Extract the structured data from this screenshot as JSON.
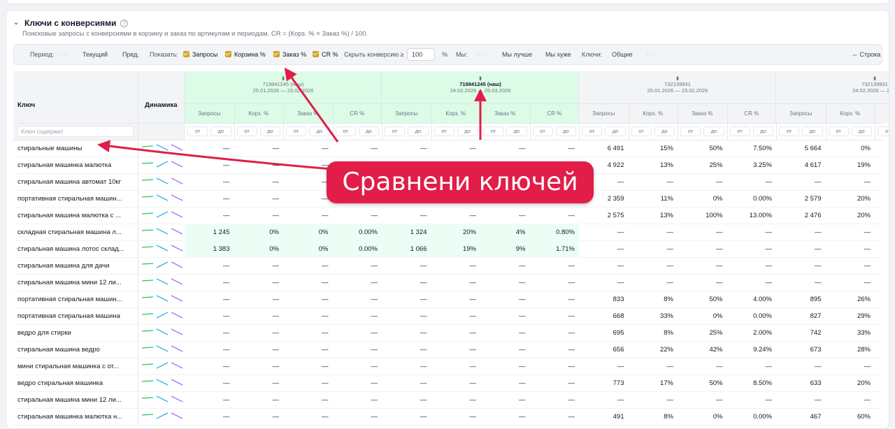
{
  "header": {
    "title": "Ключи с конверсиями",
    "subtitle": "Поисковые запросы с конверсиями в корзину и заказ по артикулам и периодам. CR = (Корз. % × Заказ %) / 100."
  },
  "toolbar": {
    "period_label": "Период:",
    "period_faded": "Оба",
    "period_current": "Текущий",
    "period_prev": "Пред.",
    "show_label": "Показать:",
    "chk_requests": "Запросы",
    "chk_cart": "Корзина %",
    "chk_order": "Заказ %",
    "chk_cr": "CR %",
    "hide_conv_label": "Скрыть конверсию ≥",
    "hide_conv_value": "100",
    "pct": "%",
    "we_label": "Мы:",
    "we_faded": "Все",
    "we_better": "Мы лучше",
    "we_worse": "Мы хуже",
    "keys_label": "Ключи:",
    "keys_common": "Общие",
    "keys_faded": "Все",
    "row_toggle": "⇔ Строка"
  },
  "colors": {
    "accent": "#d6a21e",
    "green_header": "#dcfce7",
    "green_row": "#ecfdf5",
    "banner": "#e11d48"
  },
  "table": {
    "key_header": "Ключ",
    "dyn_header": "Динамика",
    "filter_placeholder": "Ключ содержит",
    "groups": [
      {
        "id": "719841245 (наш)",
        "dates": "25.01.2026 — 23.02.2026",
        "green": true,
        "bold": false
      },
      {
        "id": "719841245 (наш)",
        "dates": "24.02.2026 — 25.03.2026",
        "green": true,
        "bold": true
      },
      {
        "id": "732139931",
        "dates": "25.01.2026 — 23.02.2026",
        "green": false,
        "bold": false
      },
      {
        "id": "732139931",
        "dates": "24.02.2026 — 25.0",
        "green": false,
        "bold": false
      }
    ],
    "subcols": [
      "Запросы",
      "Корз. %",
      "Заказ %",
      "CR %"
    ],
    "from": "от",
    "to": "до",
    "rows": [
      {
        "key": "стиральные машины",
        "hl": false,
        "v": [
          "—",
          "—",
          "—",
          "—",
          "—",
          "—",
          "—",
          "—",
          "6 491",
          "15%",
          "50%",
          "7.50%",
          "5 664",
          "0%"
        ]
      },
      {
        "key": "стиральная машинка малютка",
        "hl": false,
        "v": [
          "—",
          "—",
          "—",
          "—",
          "—",
          "—",
          "—",
          "—",
          "4 922",
          "13%",
          "25%",
          "3.25%",
          "4 617",
          "19%"
        ]
      },
      {
        "key": "стиральная машина автомат 10кг",
        "hl": false,
        "v": [
          "—",
          "—",
          "—",
          "—",
          "—",
          "—",
          "—",
          "—",
          "—",
          "—",
          "—",
          "—",
          "—",
          "—"
        ]
      },
      {
        "key": "портативная стиральная машин...",
        "hl": false,
        "v": [
          "—",
          "—",
          "—",
          "—",
          "—",
          "—",
          "—",
          "—",
          "2 359",
          "11%",
          "0%",
          "0.00%",
          "2 579",
          "20%"
        ]
      },
      {
        "key": "стиральная машина малютка с ...",
        "hl": false,
        "v": [
          "—",
          "—",
          "—",
          "—",
          "—",
          "—",
          "—",
          "—",
          "2 575",
          "13%",
          "100%",
          "13.00%",
          "2 476",
          "20%"
        ]
      },
      {
        "key": "складная стиральная машина л...",
        "hl": true,
        "v": [
          "1 245",
          "0%",
          "0%",
          "0.00%",
          "1 324",
          "20%",
          "4%",
          "0.80%",
          "—",
          "—",
          "—",
          "—",
          "—",
          "—"
        ]
      },
      {
        "key": "стиральная машина лотос склад...",
        "hl": true,
        "v": [
          "1 383",
          "0%",
          "0%",
          "0.00%",
          "1 066",
          "19%",
          "9%",
          "1.71%",
          "—",
          "—",
          "—",
          "—",
          "—",
          "—"
        ]
      },
      {
        "key": "стиральная машина для дачи",
        "hl": false,
        "v": [
          "—",
          "—",
          "—",
          "—",
          "—",
          "—",
          "—",
          "—",
          "—",
          "—",
          "—",
          "—",
          "—",
          "—"
        ]
      },
      {
        "key": "стиральная машина мини 12 ли...",
        "hl": false,
        "v": [
          "—",
          "—",
          "—",
          "—",
          "—",
          "—",
          "—",
          "—",
          "—",
          "—",
          "—",
          "—",
          "—",
          "—"
        ]
      },
      {
        "key": "портативная стиральная машин...",
        "hl": false,
        "v": [
          "—",
          "—",
          "—",
          "—",
          "—",
          "—",
          "—",
          "—",
          "833",
          "8%",
          "50%",
          "4.00%",
          "895",
          "26%"
        ]
      },
      {
        "key": "портативная стиральная машина",
        "hl": false,
        "v": [
          "—",
          "—",
          "—",
          "—",
          "—",
          "—",
          "—",
          "—",
          "668",
          "33%",
          "0%",
          "0.00%",
          "827",
          "29%"
        ]
      },
      {
        "key": "ведро для стирки",
        "hl": false,
        "v": [
          "—",
          "—",
          "—",
          "—",
          "—",
          "—",
          "—",
          "—",
          "695",
          "8%",
          "25%",
          "2.00%",
          "742",
          "33%"
        ]
      },
      {
        "key": "стиральная машина ведро",
        "hl": false,
        "v": [
          "—",
          "—",
          "—",
          "—",
          "—",
          "—",
          "—",
          "—",
          "656",
          "22%",
          "42%",
          "9.24%",
          "673",
          "28%"
        ]
      },
      {
        "key": "мини стиральная машинка с от...",
        "hl": false,
        "v": [
          "—",
          "—",
          "—",
          "—",
          "—",
          "—",
          "—",
          "—",
          "—",
          "—",
          "—",
          "—",
          "—",
          "—"
        ]
      },
      {
        "key": "ведро стиральная машинка",
        "hl": false,
        "v": [
          "—",
          "—",
          "—",
          "—",
          "—",
          "—",
          "—",
          "—",
          "773",
          "17%",
          "50%",
          "8.50%",
          "633",
          "20%"
        ]
      },
      {
        "key": "стиральная машина мини 12 ли...",
        "hl": false,
        "v": [
          "—",
          "—",
          "—",
          "—",
          "—",
          "—",
          "—",
          "—",
          "—",
          "—",
          "—",
          "—",
          "—",
          "—"
        ]
      },
      {
        "key": "стиральная машинка малютка н...",
        "hl": false,
        "v": [
          "—",
          "—",
          "—",
          "—",
          "—",
          "—",
          "—",
          "—",
          "491",
          "8%",
          "0%",
          "0.00%",
          "467",
          "60%"
        ]
      }
    ]
  },
  "annotation": {
    "banner_text": "Сравнени ключей"
  }
}
